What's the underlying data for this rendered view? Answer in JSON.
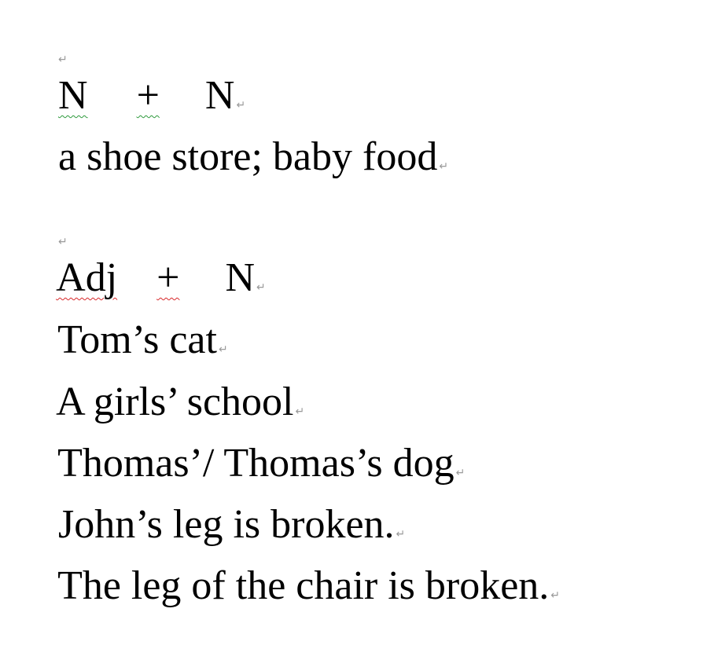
{
  "document": {
    "paragraph_mark": "↵",
    "lines": [
      {
        "id": "empty-top",
        "text": ""
      },
      {
        "id": "pattern-noun-noun",
        "left": "N",
        "plus": "+",
        "right": "N"
      },
      {
        "id": "example-noun-noun",
        "text": "a shoe store; baby food"
      },
      {
        "id": "empty-middle",
        "text": ""
      },
      {
        "id": "pattern-adj-noun",
        "left": "Adj",
        "plus": "+",
        "right": "N"
      },
      {
        "id": "example-1",
        "text": "Tom’s cat"
      },
      {
        "id": "example-2",
        "text": "A girls’ school"
      },
      {
        "id": "example-3",
        "text": "Thomas’/ Thomas’s dog"
      },
      {
        "id": "example-4",
        "text": "John’s leg is broken."
      },
      {
        "id": "example-5",
        "text": "The leg of the chair is broken."
      }
    ]
  },
  "colors": {
    "text": "#000000",
    "formatting_mark": "#9a9a9a",
    "grammar_underline": "#2e9a3c",
    "spelling_underline": "#d8282a"
  }
}
